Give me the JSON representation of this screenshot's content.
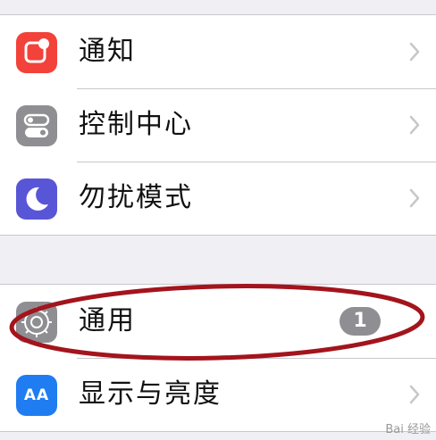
{
  "settings": {
    "group1": [
      {
        "label": "通知",
        "icon": "notifications-icon",
        "color": "#f2423a"
      },
      {
        "label": "控制中心",
        "icon": "control-center-icon",
        "color": "#8e8e93"
      },
      {
        "label": "勿扰模式",
        "icon": "do-not-disturb-icon",
        "color": "#5856d6"
      }
    ],
    "group2": [
      {
        "label": "通用",
        "icon": "gear-icon",
        "color": "#8e8e93",
        "badge": "1"
      },
      {
        "label": "显示与亮度",
        "icon": "display-brightness-icon",
        "color": "#1f7df1",
        "icon_text": "AA"
      }
    ]
  },
  "annotation": {
    "shape": "ellipse",
    "color": "#a3141c"
  },
  "watermark": {
    "text": "Bai 经验"
  }
}
